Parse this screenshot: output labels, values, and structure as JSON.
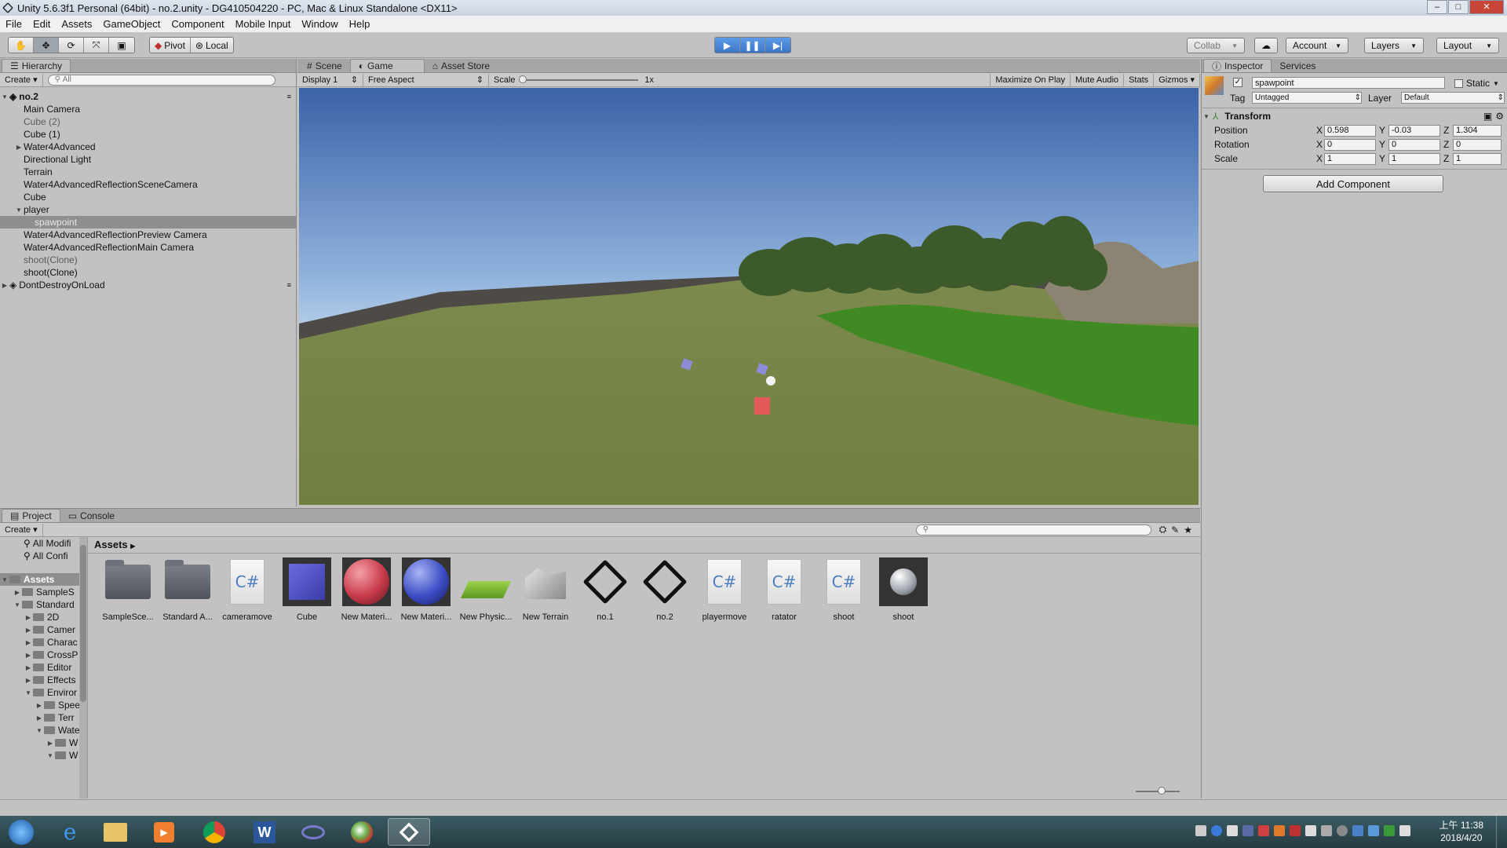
{
  "window": {
    "title": "Unity 5.6.3f1 Personal (64bit) - no.2.unity - DG410504220 - PC, Mac & Linux Standalone <DX11>",
    "minimize": "‒",
    "maximize": "□",
    "close": "✕"
  },
  "menu": [
    "File",
    "Edit",
    "Assets",
    "GameObject",
    "Component",
    "Mobile Input",
    "Window",
    "Help"
  ],
  "toolbar": {
    "pivot": "Pivot",
    "local": "Local",
    "collab": "Collab",
    "account": "Account",
    "layers": "Layers",
    "layout": "Layout"
  },
  "hierarchy": {
    "tab": "Hierarchy",
    "create": "Create",
    "search_placeholder": "All",
    "scene": "no.2",
    "items": [
      {
        "label": "Main Camera"
      },
      {
        "label": "Cube (2)"
      },
      {
        "label": "Cube (1)"
      },
      {
        "label": "Water4Advanced"
      },
      {
        "label": "Directional Light"
      },
      {
        "label": "Terrain"
      },
      {
        "label": "Water4AdvancedReflectionSceneCamera"
      },
      {
        "label": "Cube"
      },
      {
        "label": "player"
      },
      {
        "label": "spawpoint"
      },
      {
        "label": "Water4AdvancedReflectionPreview Camera"
      },
      {
        "label": "Water4AdvancedReflectionMain Camera"
      },
      {
        "label": "shoot(Clone)"
      },
      {
        "label": "shoot(Clone)"
      }
    ],
    "dontdestroy": "DontDestroyOnLoad"
  },
  "game": {
    "tabs": [
      "Scene",
      "Game",
      "Asset Store"
    ],
    "display": "Display 1",
    "aspect": "Free Aspect",
    "scale_label": "Scale",
    "scale_value": "1x",
    "maximize": "Maximize On Play",
    "mute": "Mute Audio",
    "stats": "Stats",
    "gizmos": "Gizmos"
  },
  "inspector": {
    "tabs": [
      "Inspector",
      "Services"
    ],
    "object_name": "spawpoint",
    "static": "Static",
    "tag_label": "Tag",
    "tag_value": "Untagged",
    "layer_label": "Layer",
    "layer_value": "Default",
    "transform": "Transform",
    "position": {
      "label": "Position",
      "x": "0.598",
      "y": "-0.03",
      "z": "1.304"
    },
    "rotation": {
      "label": "Rotation",
      "x": "0",
      "y": "0",
      "z": "0"
    },
    "scale": {
      "label": "Scale",
      "x": "1",
      "y": "1",
      "z": "1"
    },
    "axis_x": "X",
    "axis_y": "Y",
    "axis_z": "Z",
    "add_component": "Add Component"
  },
  "project": {
    "tabs": [
      "Project",
      "Console"
    ],
    "create": "Create",
    "breadcrumb": "Assets",
    "favorites": [
      "All Modifi",
      "All Confi"
    ],
    "tree_root": "Assets",
    "tree": [
      {
        "label": "SampleS",
        "indent": 1
      },
      {
        "label": "Standard",
        "indent": 1
      },
      {
        "label": "2D",
        "indent": 2
      },
      {
        "label": "Camer",
        "indent": 2
      },
      {
        "label": "Charac",
        "indent": 2
      },
      {
        "label": "CrossP",
        "indent": 2
      },
      {
        "label": "Editor",
        "indent": 2
      },
      {
        "label": "Effects",
        "indent": 2
      },
      {
        "label": "Enviror",
        "indent": 2
      },
      {
        "label": "Spee",
        "indent": 3
      },
      {
        "label": "Terr",
        "indent": 3
      },
      {
        "label": "Wate",
        "indent": 3
      },
      {
        "label": "W",
        "indent": 4
      },
      {
        "label": "W",
        "indent": 4
      }
    ],
    "assets": [
      {
        "label": "SampleSce...",
        "kind": "folder"
      },
      {
        "label": "Standard A...",
        "kind": "folder"
      },
      {
        "label": "cameramove",
        "kind": "script"
      },
      {
        "label": "Cube",
        "kind": "cube"
      },
      {
        "label": "New Materi...",
        "kind": "red"
      },
      {
        "label": "New Materi...",
        "kind": "blue"
      },
      {
        "label": "New Physic...",
        "kind": "physic"
      },
      {
        "label": "New Terrain",
        "kind": "terrain"
      },
      {
        "label": "no.1",
        "kind": "unity"
      },
      {
        "label": "no.2",
        "kind": "unity"
      },
      {
        "label": "playermove",
        "kind": "script"
      },
      {
        "label": "ratator",
        "kind": "script"
      },
      {
        "label": "shoot",
        "kind": "script"
      },
      {
        "label": "shoot",
        "kind": "prefab"
      }
    ],
    "script_glyph": "C#"
  },
  "console_tab": "Console",
  "clock": {
    "time": "上午 11:38",
    "date": "2018/4/20"
  },
  "colors": {
    "play_blue": "#4a8ae0",
    "editor_gray": "#c2c2c2",
    "selection": "#8e8e8e"
  }
}
